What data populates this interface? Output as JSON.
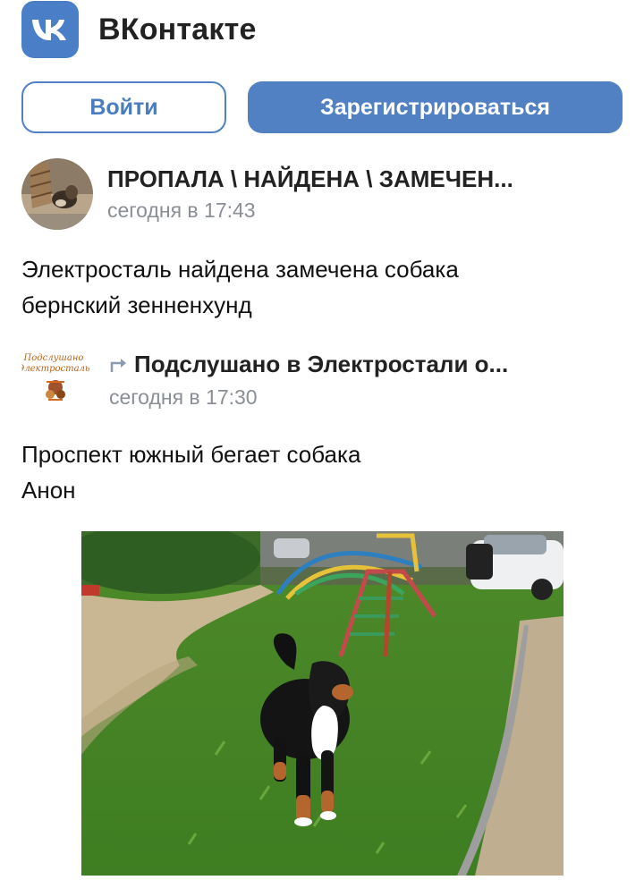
{
  "header": {
    "app_title": "ВКонтакте"
  },
  "buttons": {
    "login": "Войти",
    "register": "Зарегистрироваться"
  },
  "post": {
    "author": "ПРОПАЛА \\ НАЙДЕНА \\ ЗАМЕЧЕН...",
    "time": "сегодня в 17:43",
    "text_lines": [
      "Электросталь найдена замечена собака",
      "бернский зенненхунд"
    ]
  },
  "repost": {
    "source": "Подслушано в Электростали о...",
    "time": "сегодня в 17:30",
    "avatar_text": [
      "Подслушано",
      "Электросталь"
    ],
    "text_lines": [
      "Проспект южный бегает собака",
      "Анон"
    ]
  },
  "photo": {
    "icon": "dog-photo"
  }
}
